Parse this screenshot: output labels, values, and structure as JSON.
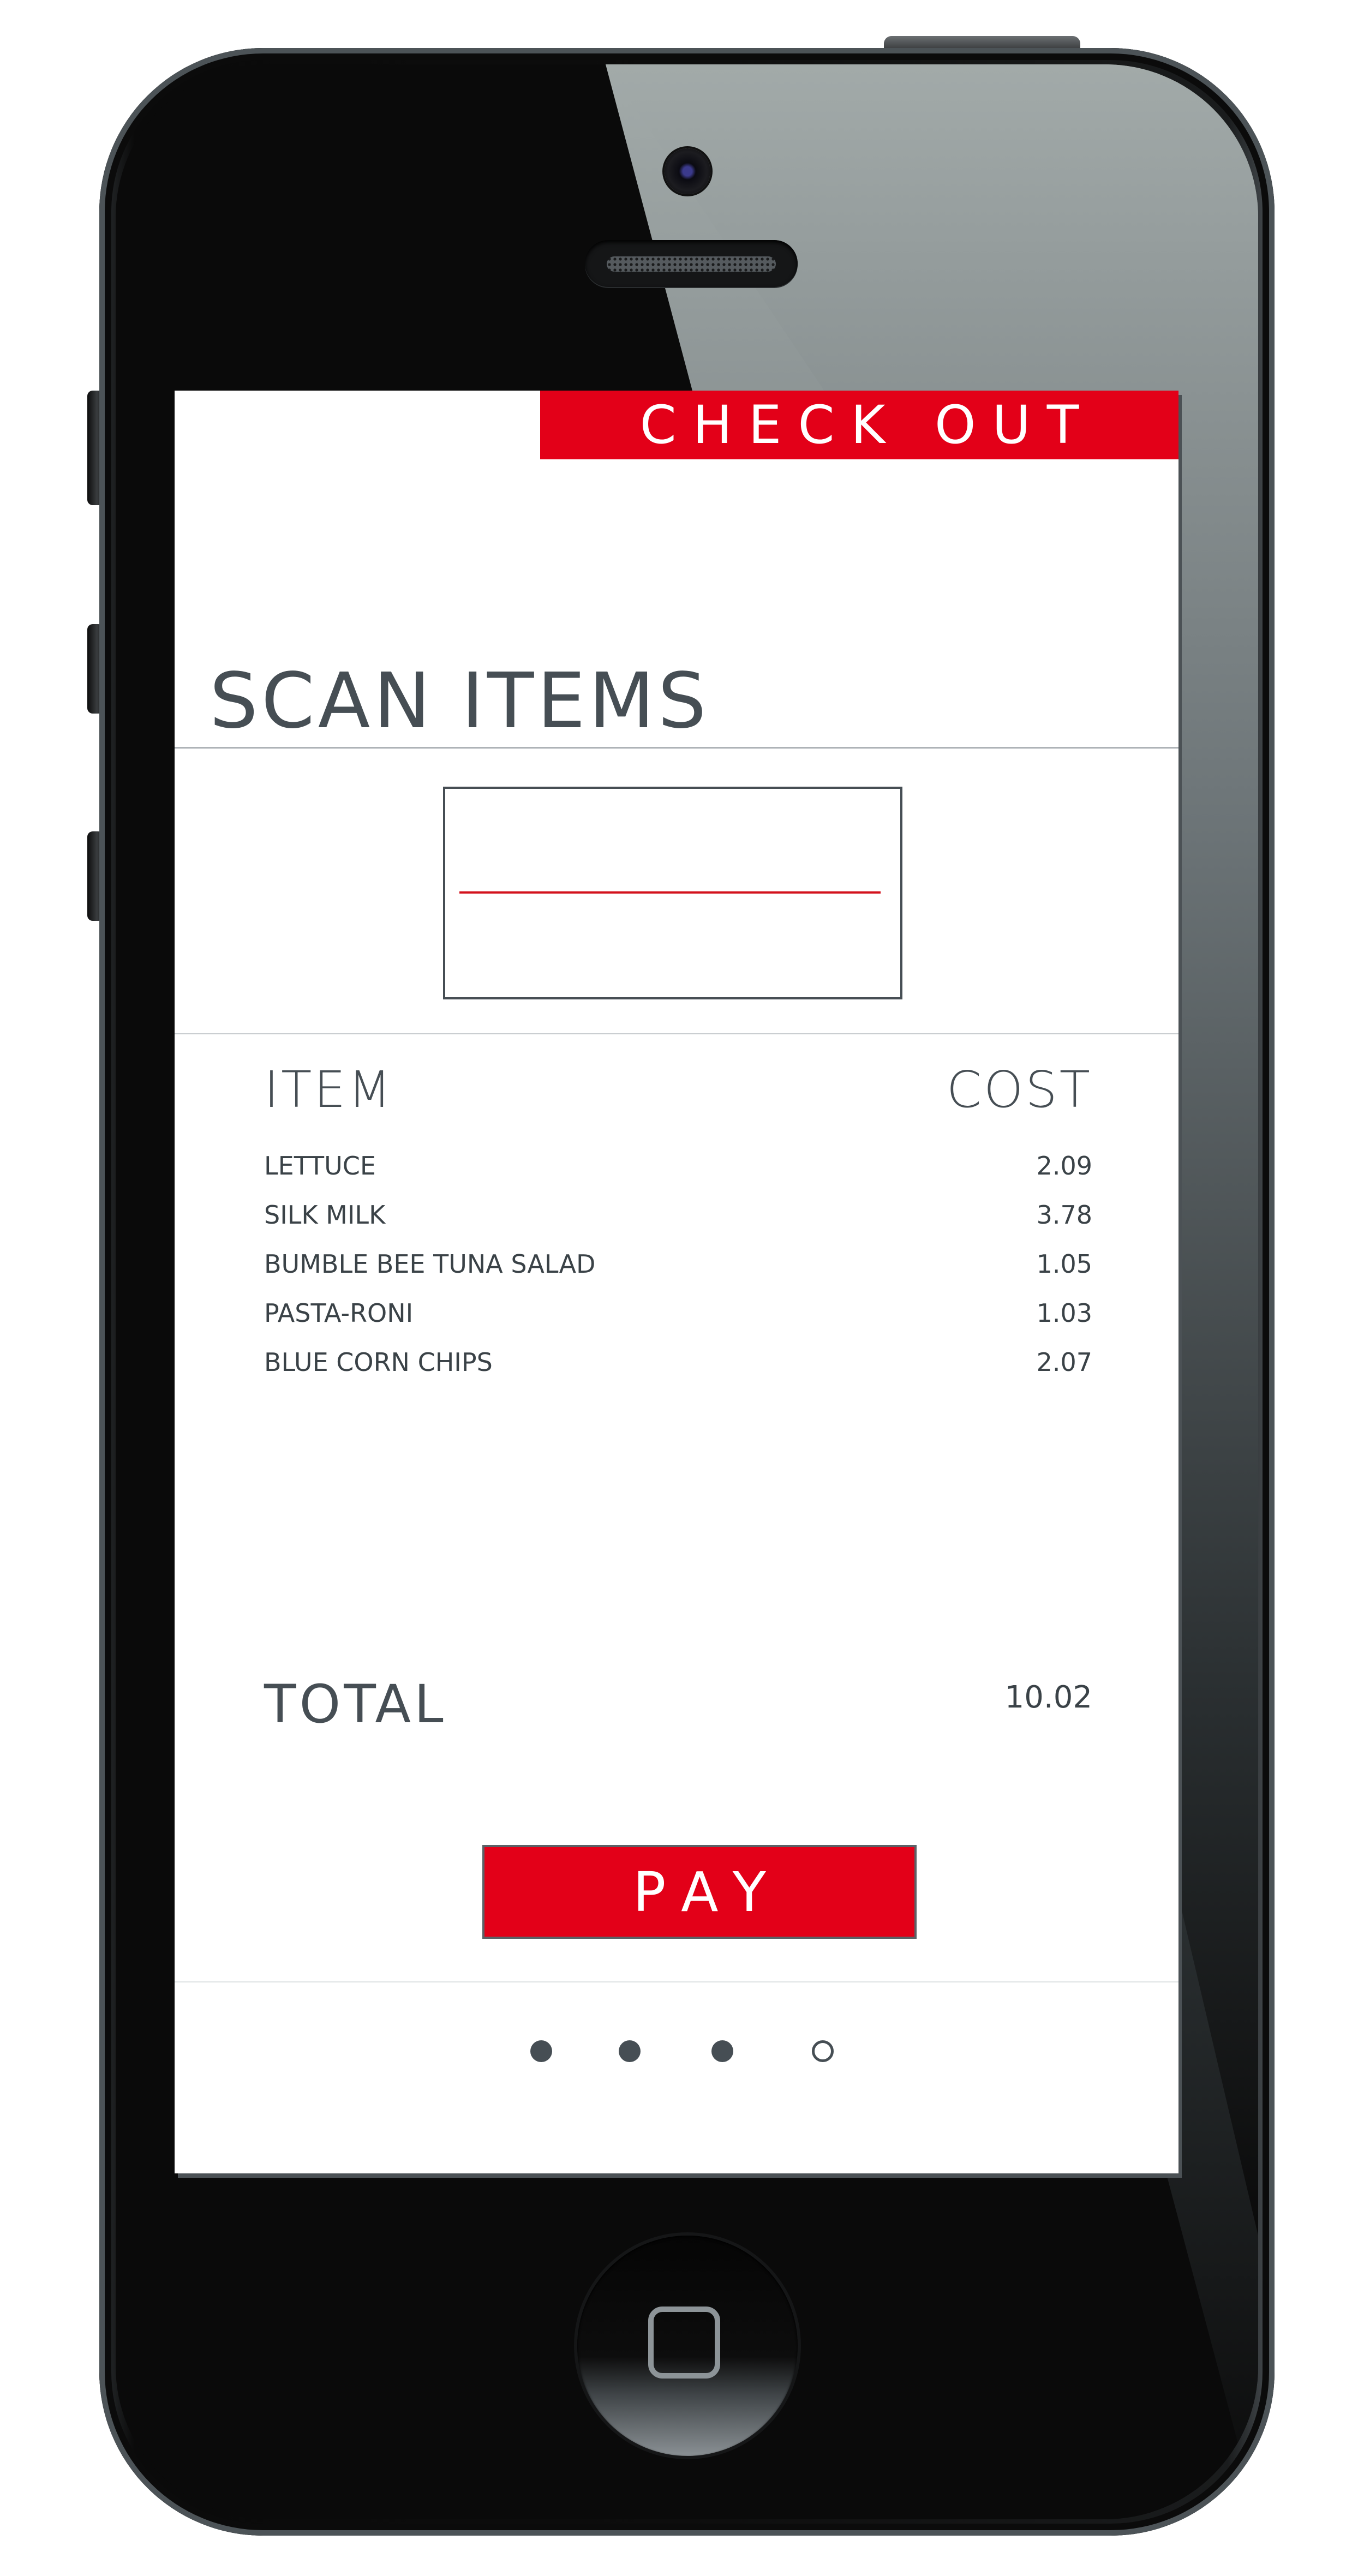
{
  "header": {
    "checkout_label": "CHECK OUT"
  },
  "scan": {
    "title": "SCAN ITEMS"
  },
  "table": {
    "columns": [
      "ITEM",
      "COST"
    ],
    "rows": [
      {
        "item": "LETTUCE",
        "cost": "2.09"
      },
      {
        "item": "SILK MILK",
        "cost": "3.78"
      },
      {
        "item": "BUMBLE BEE TUNA SALAD",
        "cost": "1.05"
      },
      {
        "item": "PASTA-RONI",
        "cost": "1.03"
      },
      {
        "item": "BLUE CORN CHIPS",
        "cost": "2.07"
      }
    ]
  },
  "summary": {
    "total_label": "TOTAL",
    "total_value": "10.02"
  },
  "actions": {
    "pay_label": "PAY"
  },
  "pager": {
    "page_count": 4,
    "active_page": 4
  },
  "colors": {
    "accent": "#e30018",
    "text": "#464e54",
    "scan_line": "#d3121c"
  },
  "icons": {
    "camera": "front-camera-icon",
    "speaker": "earpiece-speaker-icon",
    "home": "home-button-icon"
  }
}
